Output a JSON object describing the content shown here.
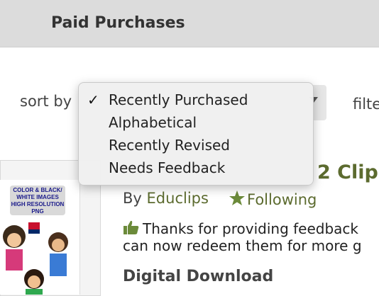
{
  "header": {
    "title": "Paid Purchases"
  },
  "sort": {
    "label": "sort by",
    "options": [
      "Recently Purchased",
      "Alphabetical",
      "Recently Revised",
      "Needs Feedback"
    ],
    "selected_check": "✓"
  },
  "filter": {
    "label": "filte"
  },
  "product": {
    "title_partial": "2 Clip",
    "by_label": "By",
    "author": "Educlips",
    "following_label": "Following",
    "feedback_line1": "Thanks for providing feedback",
    "feedback_line2": "can now redeem them for more g",
    "download_heading": "Digital Download",
    "thumbnail_text": "COLOR & BLACK/ WHITE IMAGES HIGH RESOLUTION PNG"
  },
  "colors": {
    "accent_green": "#5c6b2f",
    "header_bg": "#dcdcdc"
  },
  "icons": {
    "check": "check-icon",
    "star": "star-icon",
    "thumbs": "thumbs-up-icon"
  }
}
